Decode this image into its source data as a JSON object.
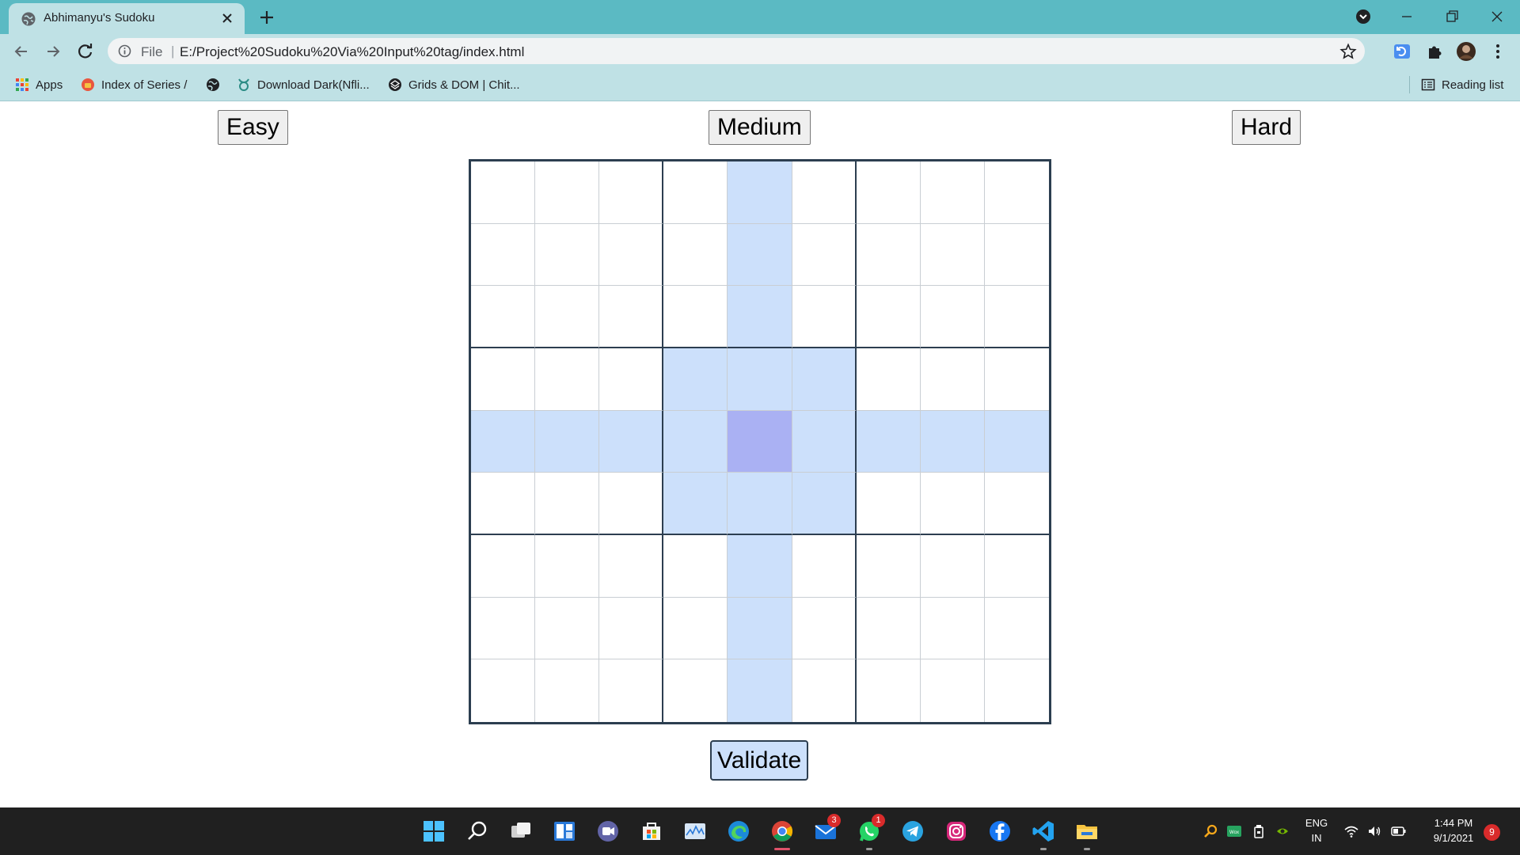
{
  "browser": {
    "tab_title": "Abhimanyu's Sudoku",
    "url_scheme_label": "File",
    "url": "E:/Project%20Sudoku%20Via%20Input%20tag/index.html",
    "bookmarks": [
      {
        "label": "Apps",
        "icon": "apps-grid-icon"
      },
      {
        "label": "Index of Series /",
        "icon": "site-favicon-icon"
      },
      {
        "label": "",
        "icon": "globe-icon"
      },
      {
        "label": "Download Dark(Nfli...",
        "icon": "taurus-icon"
      },
      {
        "label": "Grids & DOM | Chit...",
        "icon": "codepen-icon"
      }
    ],
    "reading_list_label": "Reading list"
  },
  "sudoku": {
    "level_buttons": {
      "easy": "Easy",
      "medium": "Medium",
      "hard": "Hard"
    },
    "validate_label": "Validate",
    "selected_cell": {
      "row": 5,
      "col": 5
    },
    "highlight_color": "#cce0fb",
    "selected_color": "#aab1f3",
    "cells": [
      [
        "",
        "",
        "",
        "",
        "",
        "",
        "",
        "",
        ""
      ],
      [
        "",
        "",
        "",
        "",
        "",
        "",
        "",
        "",
        ""
      ],
      [
        "",
        "",
        "",
        "",
        "",
        "",
        "",
        "",
        ""
      ],
      [
        "",
        "",
        "",
        "",
        "",
        "",
        "",
        "",
        ""
      ],
      [
        "",
        "",
        "",
        "",
        "",
        "",
        "",
        "",
        ""
      ],
      [
        "",
        "",
        "",
        "",
        "",
        "",
        "",
        "",
        ""
      ],
      [
        "",
        "",
        "",
        "",
        "",
        "",
        "",
        "",
        ""
      ],
      [
        "",
        "",
        "",
        "",
        "",
        "",
        "",
        "",
        ""
      ],
      [
        "",
        "",
        "",
        "",
        "",
        "",
        "",
        "",
        ""
      ]
    ]
  },
  "taskbar": {
    "mail_badge": "3",
    "whatsapp_badge": "1",
    "language": "ENG",
    "region": "IN",
    "time": "1:44 PM",
    "date": "9/1/2021",
    "notification_count": "9"
  }
}
